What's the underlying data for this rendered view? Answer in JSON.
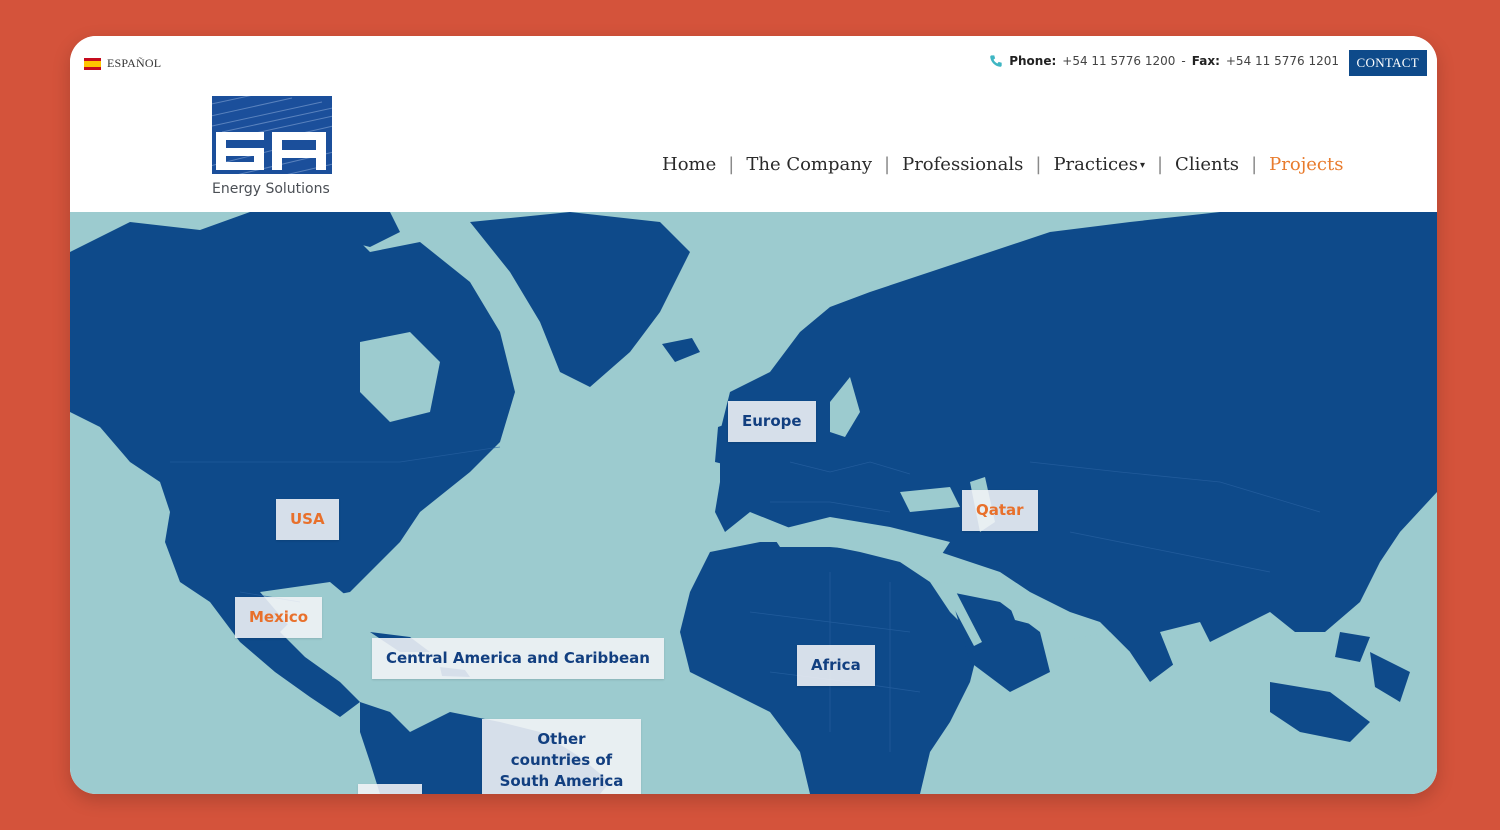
{
  "topbar": {
    "language_label": "ESPAÑOL",
    "phone_label": "Phone:",
    "phone_number": "+54 11 5776 1200",
    "separator": "-",
    "fax_label": "Fax:",
    "fax_number": "+54 11 5776 1201",
    "contact_button": "CONTACT"
  },
  "logo": {
    "text": "Energy Solutions"
  },
  "nav": {
    "items": [
      {
        "label": "Home"
      },
      {
        "label": "The Company"
      },
      {
        "label": "Professionals"
      },
      {
        "label": "Practices"
      },
      {
        "label": "Clients"
      },
      {
        "label": "Projects"
      }
    ],
    "active": "Projects"
  },
  "map": {
    "labels": {
      "europe": "Europe",
      "usa": "USA",
      "qatar": "Qatar",
      "mexico": "Mexico",
      "central_america": "Central America and Caribbean",
      "africa": "Africa",
      "south_america": "Other countries of South America"
    }
  },
  "colors": {
    "background": "#d4533b",
    "ocean": "#9ccbcf",
    "land": "#0e4a8a",
    "accent": "#e8702b",
    "label_text": "#123f80"
  }
}
